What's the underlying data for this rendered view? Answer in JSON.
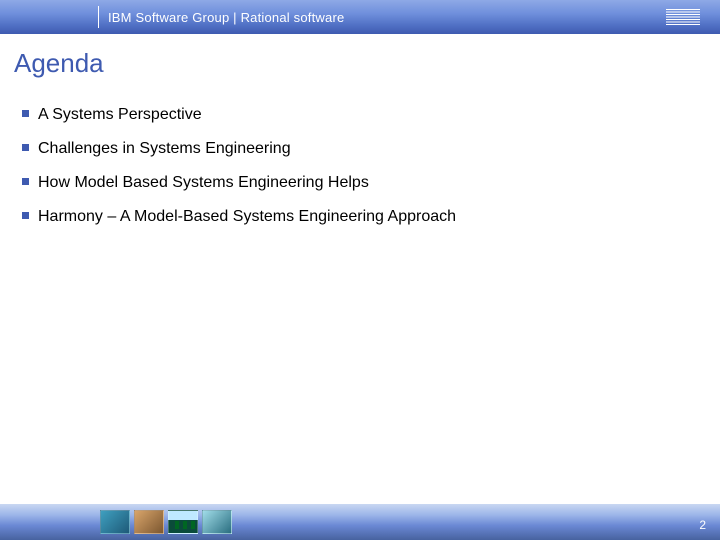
{
  "header": {
    "title": "IBM Software Group | Rational software",
    "logo_name": "IBM"
  },
  "title": "Agenda",
  "bullets": [
    "A Systems Perspective",
    "Challenges in Systems Engineering",
    "How Model Based Systems Engineering Helps",
    "Harmony – A Model-Based Systems Engineering Approach"
  ],
  "footer": {
    "page_number": "2"
  }
}
